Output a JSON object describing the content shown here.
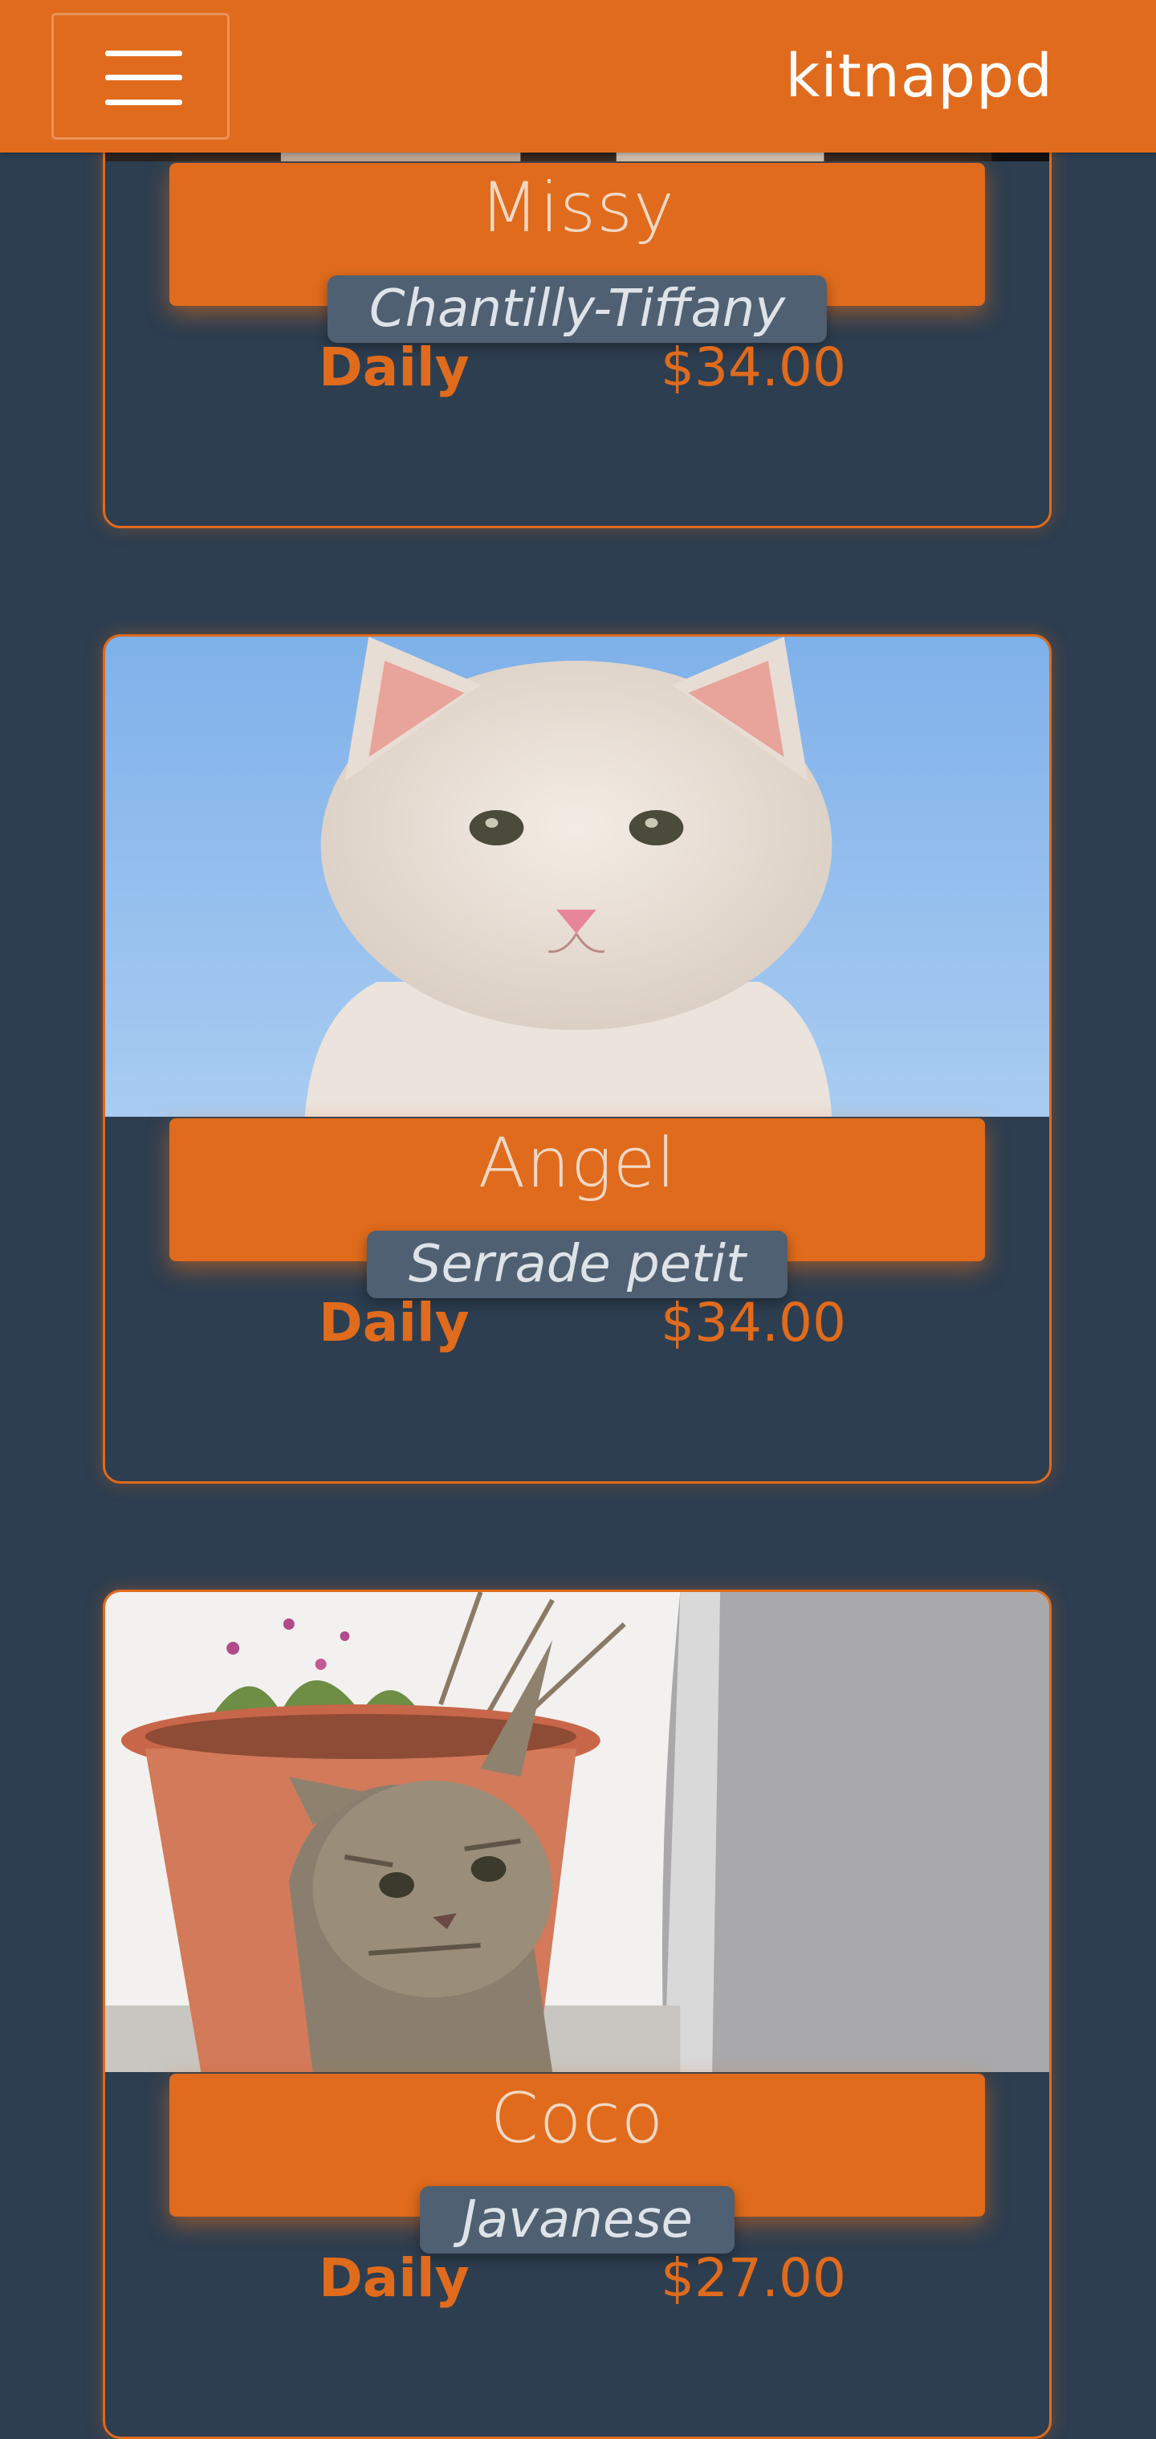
{
  "header": {
    "brand": "kitnappd",
    "menu_icon": "hamburger-menu-icon"
  },
  "colors": {
    "accent": "#e06b1c",
    "background": "#2d3e50",
    "pill": "#4f6072"
  },
  "listings": [
    {
      "name": "Missy",
      "breed": "Chantilly-Tiffany",
      "rate_label": "Daily",
      "price": "$34.00"
    },
    {
      "name": "Angel",
      "breed": "Serrade petit",
      "rate_label": "Daily",
      "price": "$34.00"
    },
    {
      "name": "Coco",
      "breed": "Javanese",
      "rate_label": "Daily",
      "price": "$27.00"
    }
  ]
}
